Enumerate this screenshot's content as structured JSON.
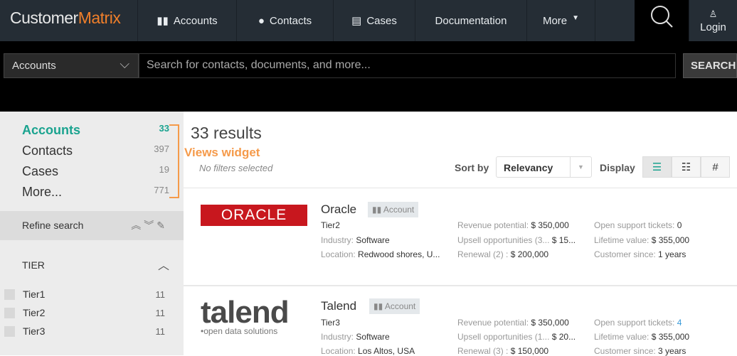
{
  "nav": {
    "logo_a": "Customer",
    "logo_b": "Matrix",
    "items": [
      {
        "label": "Accounts",
        "icon": "building-icon"
      },
      {
        "label": "Contacts",
        "icon": "user-icon"
      },
      {
        "label": "Cases",
        "icon": "case-icon"
      },
      {
        "label": "Documentation"
      },
      {
        "label": "More"
      }
    ],
    "login": "Login"
  },
  "search": {
    "scope": "Accounts",
    "placeholder": "Search for contacts, documents, and more...",
    "button": "SEARCH"
  },
  "views": [
    {
      "label": "Accounts",
      "count": "33"
    },
    {
      "label": "Contacts",
      "count": "397"
    },
    {
      "label": "Cases",
      "count": "19"
    },
    {
      "label": "More...",
      "count": "771"
    }
  ],
  "annotation": "Views widget",
  "refine": "Refine search",
  "facet": {
    "title": "TIER",
    "items": [
      {
        "label": "Tier1",
        "count": "11"
      },
      {
        "label": "Tier2",
        "count": "11"
      },
      {
        "label": "Tier3",
        "count": "11"
      }
    ]
  },
  "results": {
    "count": "33 results",
    "filters": "No filters selected",
    "sort_label": "Sort by",
    "sort_value": "Relevancy",
    "display_label": "Display",
    "items": [
      {
        "logo": "ORACLE",
        "name": "Oracle",
        "badge": "Account",
        "tier": "Tier2",
        "industry_l": "Industry:",
        "industry": "Software",
        "location_l": "Location:",
        "location": "Redwood shores, U...",
        "rev_l": "Revenue potential:",
        "rev": "$ 350,000",
        "upsell_l": "Upsell opportunities (3...",
        "upsell": "$ 15...",
        "renew_l": "Renewal (2) :",
        "renew": "$ 200,000",
        "tickets_l": "Open support tickets:",
        "tickets": "0",
        "life_l": "Lifetime value:",
        "life": "$ 355,000",
        "since_l": "Customer since:",
        "since": "1 years"
      },
      {
        "logo": "talend",
        "logo_sub": "•open data solutions",
        "name": "Talend",
        "badge": "Account",
        "tier": "Tier3",
        "industry_l": "Industry:",
        "industry": "Software",
        "location_l": "Location:",
        "location": "Los Altos, USA",
        "rev_l": "Revenue potential:",
        "rev": "$ 350,000",
        "upsell_l": "Upsell opportunities (1...",
        "upsell": "$ 20...",
        "renew_l": "Renewal (3) :",
        "renew": "$ 150,000",
        "tickets_l": "Open support tickets:",
        "tickets": "4",
        "life_l": "Lifetime value:",
        "life": "$ 355,000",
        "since_l": "Customer since:",
        "since": "3 years"
      }
    ]
  }
}
